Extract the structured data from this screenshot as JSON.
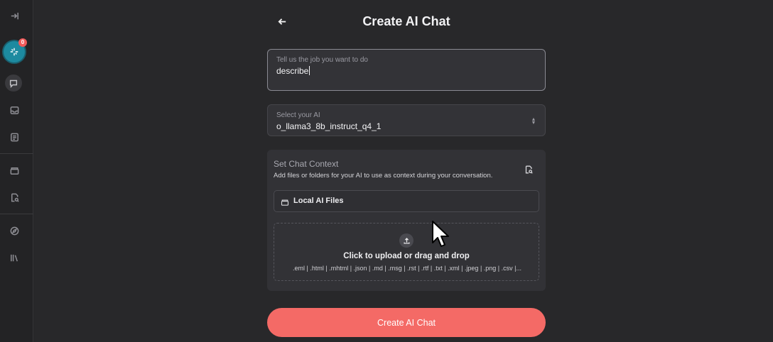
{
  "sidebar": {
    "notification_count": "0",
    "icons": [
      "collapse-icon",
      "ai-sparkle-icon",
      "chat-icon",
      "inbox-icon",
      "notes-icon",
      "archive-icon",
      "file-search-icon",
      "compass-icon",
      "library-icon"
    ]
  },
  "header": {
    "title": "Create AI Chat"
  },
  "form": {
    "job_label": "Tell us the job you want to do",
    "job_value": "describe",
    "ai_label": "Select your AI",
    "ai_value": "o_llama3_8b_instruct_q4_1"
  },
  "context": {
    "title": "Set Chat Context",
    "description": "Add files or folders for your AI to use as context during your conversation.",
    "local_files_label": "Local AI Files",
    "upload_title": "Click to upload or drag and drop",
    "upload_types": ".eml | .html | .mhtml | .json | .md | .msg | .rst | .rtf | .txt | .xml | .jpeg | .png | .csv |..."
  },
  "actions": {
    "create_label": "Create AI Chat"
  },
  "colors": {
    "background": "#28282a",
    "accent": "#f46a66",
    "ai_bubble": "#1d8aa0",
    "badge": "#ef5a5a"
  }
}
